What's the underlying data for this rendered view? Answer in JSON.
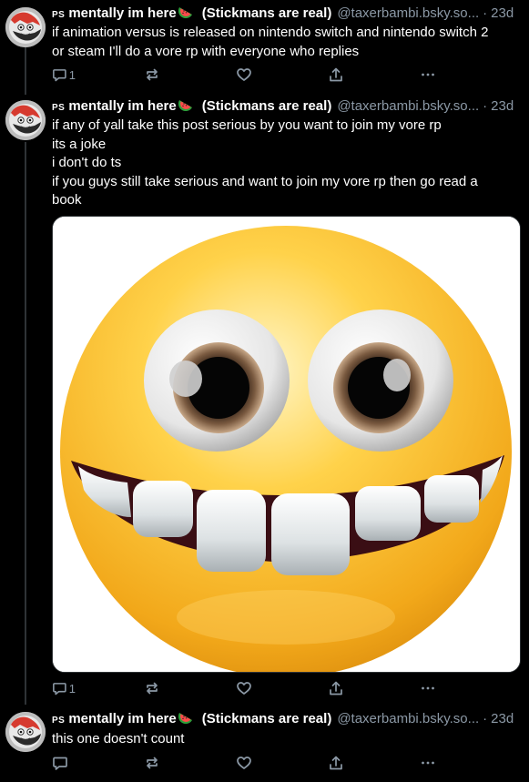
{
  "posts": [
    {
      "badge": "PS",
      "display_name": "mentally im here",
      "tagline": "(Stickmans are real)",
      "handle": "@taxerbambi.bsky.so...",
      "separator": "·",
      "time": "23d",
      "lines": [
        "if animation versus is released on nintendo switch and nintendo switch 2",
        "or steam I'll do a vore rp with everyone who replies"
      ],
      "reply_count": "1",
      "repost_count": "",
      "like_count": ""
    },
    {
      "badge": "PS",
      "display_name": "mentally im here",
      "tagline": "(Stickmans are real)",
      "handle": "@taxerbambi.bsky.so...",
      "separator": "·",
      "time": "23d",
      "lines": [
        "if any of yall take this post serious by you want to join my vore rp",
        "its a joke",
        "i don't do ts",
        "if you guys still take serious and want to join my vore rp then go read a",
        "book"
      ],
      "reply_count": "1",
      "repost_count": "",
      "like_count": ""
    },
    {
      "badge": "PS",
      "display_name": "mentally im here",
      "tagline": "(Stickmans are real)",
      "handle": "@taxerbambi.bsky.so...",
      "separator": "·",
      "time": "23d",
      "lines": [
        "this one doesn't count"
      ],
      "reply_count": "",
      "repost_count": "",
      "like_count": ""
    }
  ],
  "icons": {
    "reply": "reply-icon",
    "repost": "repost-icon",
    "like": "heart-icon",
    "share": "share-icon",
    "more": "more-icon",
    "name_emoji": "watermelon-icon"
  },
  "colors": {
    "background": "#000000",
    "text": "#ffffff",
    "muted": "#8b98a5",
    "divider": "#2f3336"
  }
}
